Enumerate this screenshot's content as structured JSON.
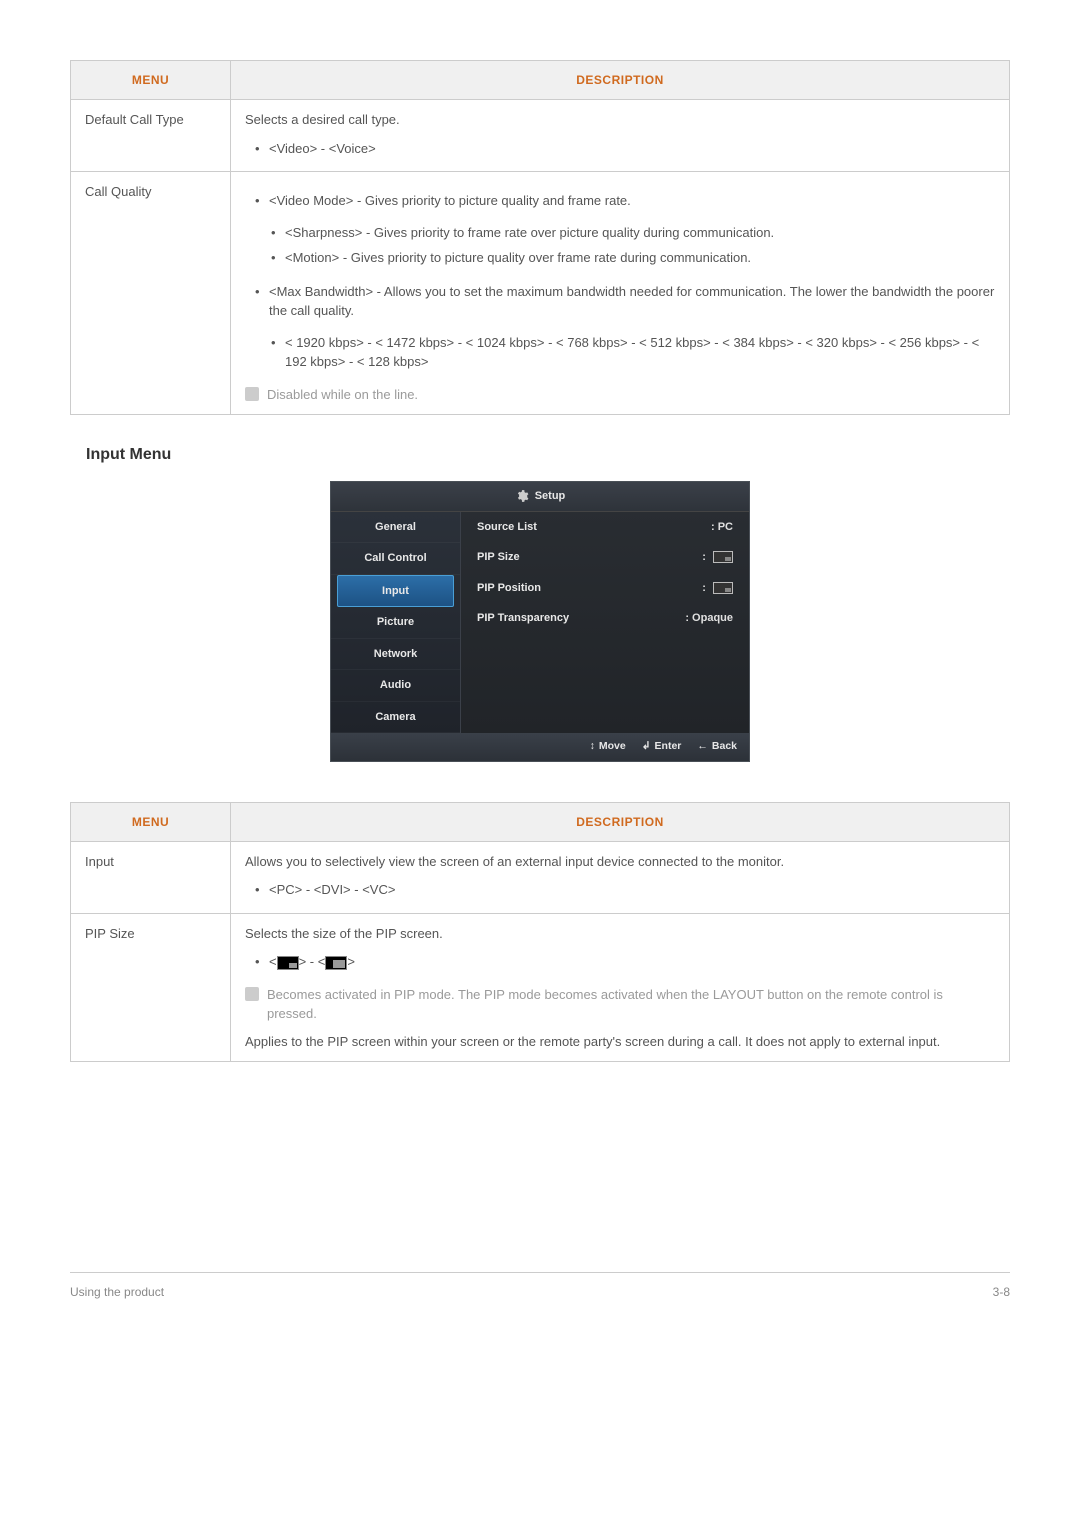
{
  "table1": {
    "headers": {
      "menu": "MENU",
      "desc": "DESCRIPTION"
    },
    "rows": [
      {
        "menu": "Default Call Type",
        "intro": "Selects a desired call type.",
        "bullets": [
          "<Video> - <Voice>"
        ]
      },
      {
        "menu": "Call Quality",
        "bullets": [
          "<Video Mode> - Gives priority to picture quality and frame rate."
        ],
        "sub_bullets": [
          "<Sharpness> - Gives priority to frame rate over picture quality during communication.",
          "<Motion> - Gives priority to picture quality over frame rate during communication."
        ],
        "bullets2": [
          "<Max Bandwidth> - Allows you to set the maximum bandwidth needed for communication. The lower the bandwidth the poorer the call quality."
        ],
        "sub_bullets2": [
          "< 1920 kbps> - < 1472 kbps> - < 1024 kbps> - < 768 kbps> - < 512 kbps> - < 384 kbps> - < 320 kbps> - < 256 kbps> - < 192 kbps> - < 128 kbps>"
        ],
        "note": "Disabled while on the line."
      }
    ]
  },
  "section_heading": "Input Menu",
  "osd": {
    "title": "Setup",
    "side": [
      "General",
      "Call Control",
      "Input",
      "Picture",
      "Network",
      "Audio",
      "Camera"
    ],
    "active_index": 2,
    "rows": [
      {
        "label": "Source List",
        "value": ": PC",
        "type": "text"
      },
      {
        "label": "PIP Size",
        "value": ":",
        "type": "pip-small"
      },
      {
        "label": "PIP Position",
        "value": ":",
        "type": "pip-small"
      },
      {
        "label": "PIP Transparency",
        "value": ": Opaque",
        "type": "text"
      }
    ],
    "foot": {
      "move": "Move",
      "enter": "Enter",
      "back": "Back"
    }
  },
  "table2": {
    "headers": {
      "menu": "MENU",
      "desc": "DESCRIPTION"
    },
    "rows": [
      {
        "menu": "Input",
        "intro": "Allows you to selectively view the screen of an external input device connected to the monitor.",
        "bullets": [
          "<PC> - <DVI> - <VC>"
        ]
      },
      {
        "menu": "PIP Size",
        "intro": "Selects the size of the PIP screen.",
        "pip_bullet_prefix": "<",
        "pip_bullet_mid": "> - <",
        "pip_bullet_suffix": ">",
        "note": "Becomes activated in PIP mode. The PIP mode becomes activated when the LAYOUT button on the remote control is pressed.",
        "after_note": "Applies to the PIP screen within your screen or the remote party's screen during a call. It does not apply to external input."
      }
    ]
  },
  "footer": {
    "left": "Using the product",
    "right": "3-8"
  }
}
